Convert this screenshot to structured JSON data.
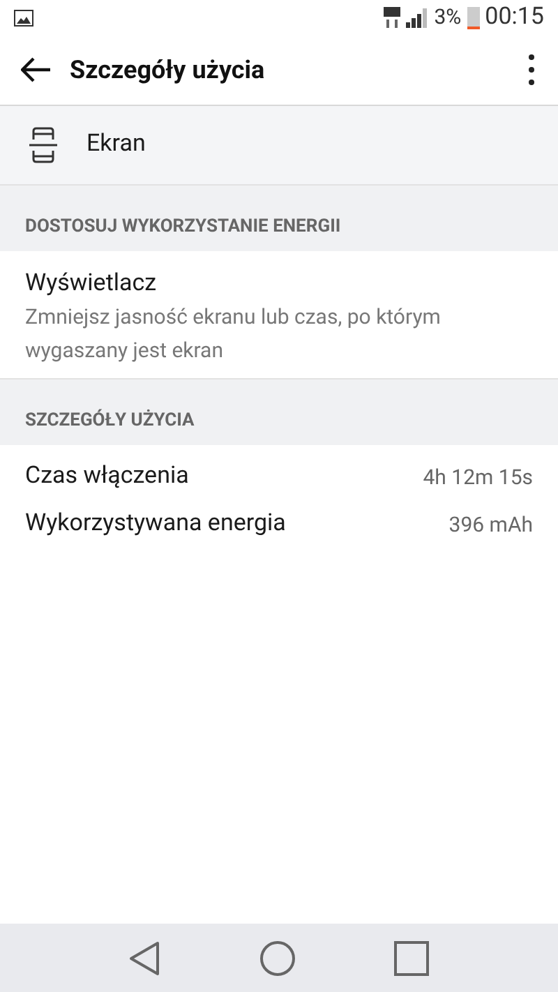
{
  "status_bar": {
    "battery_percent": "3%",
    "time": "00:15"
  },
  "app_bar": {
    "title": "Szczegóły użycia"
  },
  "app_item": {
    "name": "Ekran"
  },
  "sections": [
    {
      "header": "DOSTOSUJ WYKORZYSTANIE ENERGII",
      "items": [
        {
          "kind": "suggestion",
          "title": "Wyświetlacz",
          "summary": "Zmniejsz jasność ekranu lub czas, po którym wygaszany jest ekran"
        }
      ]
    },
    {
      "header": "SZCZEGÓŁY UŻYCIA",
      "items": [
        {
          "kind": "stat",
          "title": "Czas włączenia",
          "value": "4h 12m 15s"
        },
        {
          "kind": "stat",
          "title": "Wykorzystywana energia",
          "value": "396 mAh"
        }
      ]
    }
  ]
}
